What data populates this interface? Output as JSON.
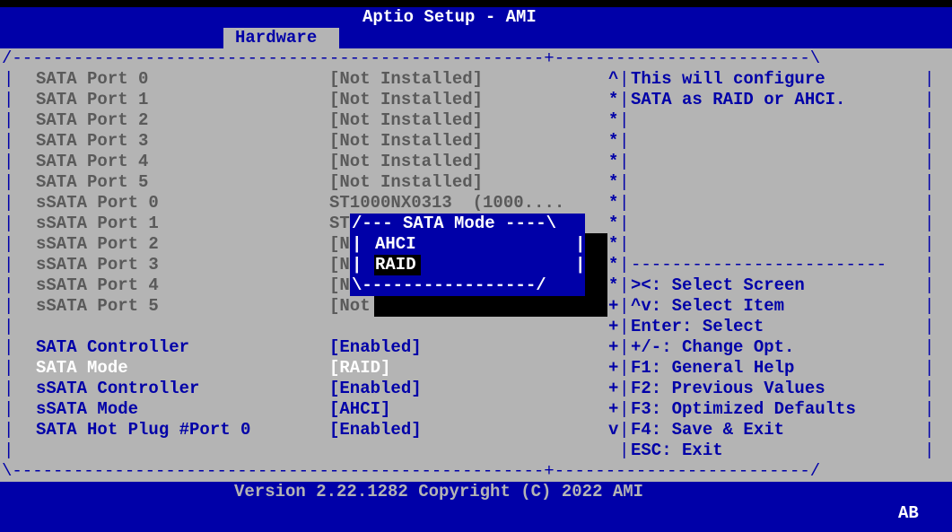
{
  "header": {
    "title": "Aptio Setup - AMI",
    "tab": "Hardware"
  },
  "settings": [
    {
      "label": "SATA Port 0",
      "value": "[Not Installed]"
    },
    {
      "label": "SATA Port 1",
      "value": "[Not Installed]"
    },
    {
      "label": "SATA Port 2",
      "value": "[Not Installed]"
    },
    {
      "label": "SATA Port 3",
      "value": "[Not Installed]"
    },
    {
      "label": "SATA Port 4",
      "value": "[Not Installed]"
    },
    {
      "label": "SATA Port 5",
      "value": "[Not Installed]"
    },
    {
      "label": "sSATA Port 0",
      "value": "ST1000NX0313  (1000...."
    },
    {
      "label": "sSATA Port 1",
      "value": "ST"
    },
    {
      "label": "sSATA Port 2",
      "value": "[N"
    },
    {
      "label": "sSATA Port 3",
      "value": "[N"
    },
    {
      "label": "sSATA Port 4",
      "value": "[N"
    },
    {
      "label": "sSATA Port 5",
      "value": "[Not"
    },
    {
      "label": "SATA Controller",
      "value": "[Enabled]"
    },
    {
      "label": "SATA Mode",
      "value": "[RAID]"
    },
    {
      "label": "sSATA Controller",
      "value": "[Enabled]"
    },
    {
      "label": "sSATA Mode",
      "value": "[AHCI]"
    },
    {
      "label": "SATA Hot Plug #Port 0",
      "value": "[Enabled]"
    }
  ],
  "help": {
    "line1": "This will configure",
    "line2": "SATA as RAID or AHCI."
  },
  "keys": [
    "><: Select Screen",
    "^v: Select Item",
    "Enter: Select",
    "+/-: Change Opt.",
    "F1: General Help",
    "F2: Previous Values",
    "F3: Optimized Defaults",
    "F4: Save & Exit",
    "ESC: Exit"
  ],
  "popup": {
    "title": "SATA Mode",
    "options": [
      "AHCI",
      "RAID"
    ],
    "selected": "RAID"
  },
  "footer": {
    "version": "Version 2.22.1282 Copyright (C) 2022 AMI",
    "badge": "AB"
  },
  "colors": {
    "blue": "#0000a8",
    "gray": "#b4b4b4",
    "white": "#ffffff",
    "dim": "#5a5a5a"
  }
}
